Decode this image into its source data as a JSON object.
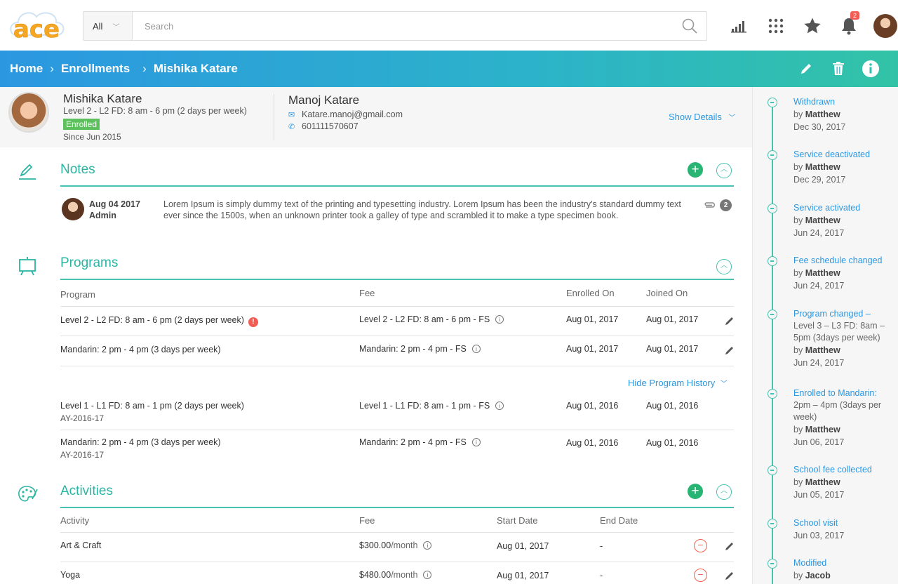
{
  "logo": {
    "text": "ace"
  },
  "search": {
    "scope": "All",
    "placeholder": "Search"
  },
  "header": {
    "notification_count": "2"
  },
  "breadcrumb": {
    "home": "Home",
    "enrollments": "Enrollments",
    "current": "Mishika Katare"
  },
  "student": {
    "name": "Mishika Katare",
    "program": "Level 2 - L2 FD:  8 am - 6 pm  (2 days per week)",
    "status": "Enrolled",
    "since": "Since Jun 2015"
  },
  "guardian": {
    "name": "Manoj Katare",
    "email": "Katare.manoj@gmail.com",
    "phone": "601111570607",
    "show_details": "Show Details"
  },
  "notes": {
    "title": "Notes",
    "items": [
      {
        "date": "Aug 04 2017",
        "author": "Admin",
        "text": "Lorem Ipsum is simply dummy text of the printing and typesetting industry. Lorem Ipsum has been the industry's standard dummy text ever since the 1500s, when an unknown printer took a galley of type and scrambled it to make a type specimen book.",
        "attachments": "2"
      }
    ]
  },
  "programs": {
    "title": "Programs",
    "headers": {
      "program": "Program",
      "fee": "Fee",
      "enrolled_on": "Enrolled On",
      "joined_on": "Joined On"
    },
    "rows": [
      {
        "program": "Level 2 - L2 FD:  8 am - 6 pm  (2 days per week)",
        "fee": "Level 2 - L2 FD:  8 am - 6 pm - FS",
        "enrolled_on": "Aug 01, 2017",
        "joined_on": "Aug 01, 2017",
        "alert": "!"
      },
      {
        "program": "Mandarin:  2 pm - 4 pm  (3 days per week)",
        "fee": "Mandarin:  2 pm - 4 pm - FS",
        "enrolled_on": "Aug 01, 2017",
        "joined_on": "Aug 01, 2017"
      }
    ],
    "hide_history": "Hide Program History",
    "history": [
      {
        "program": "Level 1 - L1 FD: 8 am - 1 pm (2 days per week)",
        "year": "AY-2016-17",
        "fee": "Level 1 - L1 FD: 8 am - 1 pm - FS",
        "enrolled_on": "Aug 01, 2016",
        "joined_on": "Aug 01, 2016"
      },
      {
        "program": "Mandarin:  2 pm - 4 pm  (3 days per week)",
        "year": "AY-2016-17",
        "fee": "Mandarin:  2 pm - 4 pm - FS",
        "enrolled_on": "Aug 01, 2016",
        "joined_on": "Aug 01, 2016"
      }
    ]
  },
  "activities": {
    "title": "Activities",
    "headers": {
      "activity": "Activity",
      "fee": "Fee",
      "start_date": "Start Date",
      "end_date": "End Date"
    },
    "rows": [
      {
        "activity": "Art & Craft",
        "fee_amount": "$300.00",
        "fee_period": "/month",
        "start_date": "Aug 01, 2017",
        "end_date": "-"
      },
      {
        "activity": "Yoga",
        "fee_amount": "$480.00",
        "fee_period": "/month",
        "start_date": "Aug 01, 2017",
        "end_date": "-"
      }
    ]
  },
  "timeline": [
    {
      "title": "Withdrawn",
      "by_prefix": "by",
      "by": "Matthew",
      "date": "Dec 30, 2017"
    },
    {
      "title": "Service deactivated",
      "by_prefix": "by",
      "by": "Matthew",
      "date": "Dec 29, 2017"
    },
    {
      "title": "Service activated",
      "by_prefix": "by",
      "by": "Matthew",
      "date": "Jun 24, 2017"
    },
    {
      "title": "Fee schedule changed",
      "by_prefix": "by",
      "by": "Matthew",
      "date": "Jun 24, 2017"
    },
    {
      "title": "Program changed –",
      "detail": "Level 3 – L3 FD: 8am – 5pm (3days per week)",
      "by_prefix": "by",
      "by": "Matthew",
      "date": "Jun 24, 2017"
    },
    {
      "title": "Enrolled to Mandarin:",
      "detail": "2pm – 4pm (3days per week)",
      "by_prefix": "by",
      "by": "Matthew",
      "date": "Jun 06, 2017"
    },
    {
      "title": "School fee collected",
      "by_prefix": "by",
      "by": "Matthew",
      "date": "Jun 05, 2017"
    },
    {
      "title": "School visit",
      "date": "Jun 03, 2017"
    },
    {
      "title": "Modified",
      "by_prefix": "by",
      "by": "Jacob"
    }
  ]
}
